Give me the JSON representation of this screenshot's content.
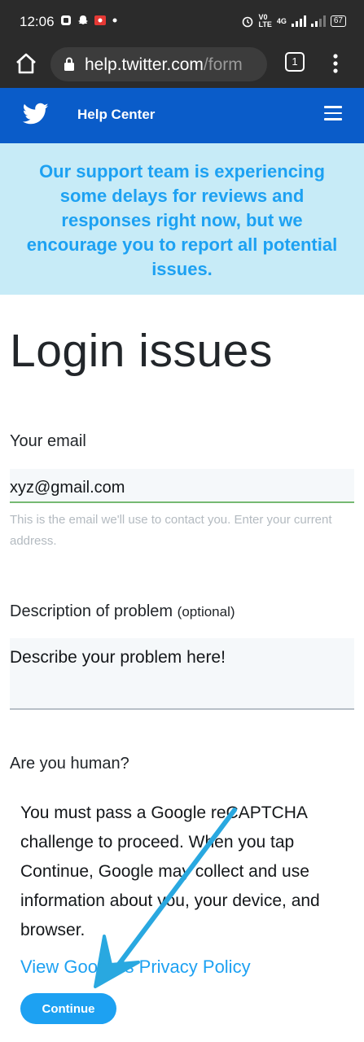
{
  "status_bar": {
    "time": "12:06",
    "network": "4G",
    "battery": "67"
  },
  "browser": {
    "url_host": "help.twitter.com",
    "url_path": "/form",
    "tab_count": "1"
  },
  "header": {
    "title": "Help Center"
  },
  "banner": {
    "text": "Our support team is experiencing some delays for reviews and responses right now, but we encourage you to report all potential issues."
  },
  "page": {
    "title": "Login issues"
  },
  "form": {
    "email_label": "Your email",
    "email_value": "xyz@gmail.com",
    "email_helper": "This is the email we'll use to contact you. Enter your current address.",
    "description_label": "Description of problem",
    "description_optional": "(optional)",
    "description_placeholder": "Describe your problem here!",
    "human_label": "Are you human?",
    "captcha_text": "You must pass a Google reCAPTCHA challenge to proceed. When you tap Continue, Google may collect and use information about you, your device, and browser.",
    "privacy_link": "View Google's Privacy Policy",
    "continue_label": "Continue"
  },
  "colors": {
    "twitter_blue": "#1da1f2",
    "header_blue": "#0a5cc9",
    "banner_bg": "#c7ebf7",
    "annotation_arrow": "#29a8e0"
  }
}
